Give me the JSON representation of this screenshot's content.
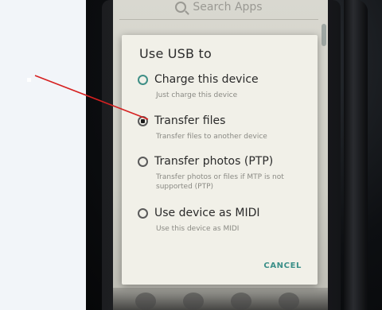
{
  "search": {
    "placeholder": "Search Apps"
  },
  "dialog": {
    "title": "Use USB to",
    "options": [
      {
        "label": "Charge this device",
        "description": "Just charge this device",
        "selected": false
      },
      {
        "label": "Transfer files",
        "description": "Transfer files to another device",
        "selected": true
      },
      {
        "label": "Transfer photos (PTP)",
        "description": "Transfer photos or files if MTP is not supported (PTP)",
        "selected": false
      },
      {
        "label": "Use device as MIDI",
        "description": "Use this device as MIDI",
        "selected": false
      }
    ],
    "cancel_label": "CANCEL"
  },
  "colors": {
    "accent": "#3b8f88",
    "annotation_arrow": "#d62020",
    "dialog_bg": "#f1f0e8"
  }
}
